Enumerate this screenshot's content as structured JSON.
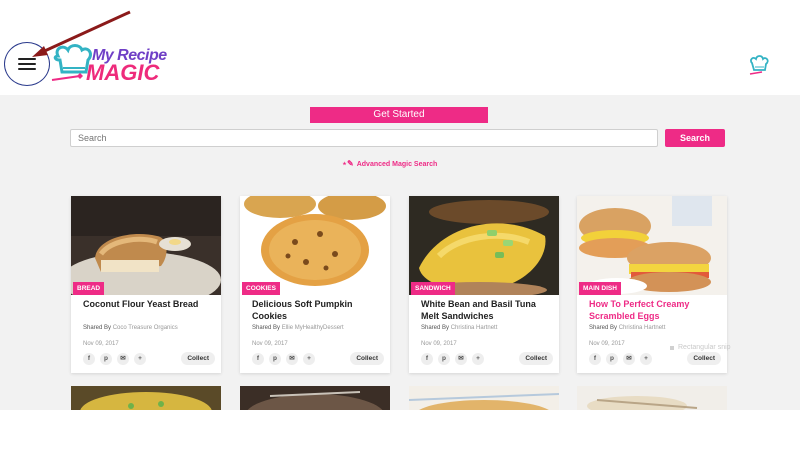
{
  "brand": {
    "line1": "My Recipe",
    "line2": "MAGIC",
    "pink": "#ee2b86",
    "purple": "#6f3fc6",
    "teal": "#33b3c4"
  },
  "header": {
    "menu_icon": "hamburger-menu-icon",
    "user_icon": "chef-hat-user-icon"
  },
  "hero": {
    "get_started_label": "Get Started",
    "search_placeholder": "Search",
    "search_button_label": "Search",
    "advanced_search_label": "Advanced Magic Search"
  },
  "cards": [
    {
      "category": "BREAD",
      "title": "Coconut Flour Yeast Bread",
      "shared_prefix": "Shared By",
      "author": "Coco Treasure Organics",
      "date": "Nov 09, 2017",
      "collect_label": "Collect"
    },
    {
      "category": "COOKIES",
      "title": "Delicious Soft Pumpkin Cookies",
      "shared_prefix": "Shared By",
      "author": "Ellie MyHealthyDessert",
      "date": "Nov 09, 2017",
      "collect_label": "Collect"
    },
    {
      "category": "SANDWICH",
      "title": "White Bean and Basil Tuna Melt Sandwiches",
      "shared_prefix": "Shared By",
      "author": "Christina Hartnett",
      "date": "Nov 09, 2017",
      "collect_label": "Collect"
    },
    {
      "category": "MAIN DISH",
      "title": "How To Perfect Creamy Scrambled Eggs",
      "shared_prefix": "Shared By",
      "author": "Christina Hartnett",
      "date": "Nov 09, 2017",
      "collect_label": "Collect"
    }
  ],
  "social_icons": [
    "facebook-icon",
    "pinterest-icon",
    "email-icon",
    "plus-icon"
  ],
  "tooltip": {
    "text": "Rectangular snip"
  }
}
